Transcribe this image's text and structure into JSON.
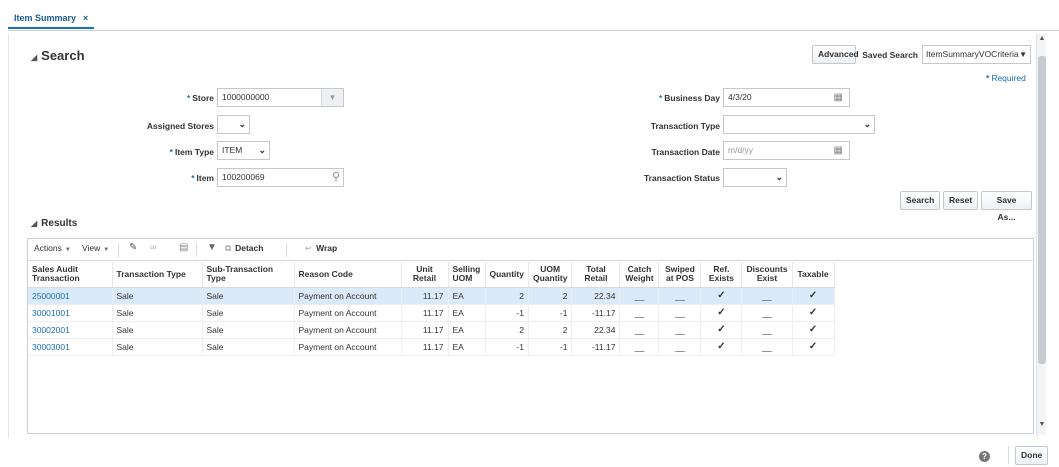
{
  "tab": {
    "label": "Item Summary",
    "close": "×"
  },
  "search": {
    "title": "Search",
    "advanced_label": "Advanced",
    "saved_search_label": "Saved Search",
    "saved_search_value": "ItemSummaryVOCriteria",
    "required_note": "Required",
    "fields": {
      "store": {
        "label": "Store",
        "value": "1000000000"
      },
      "assigned_stores": {
        "label": "Assigned Stores",
        "value": ""
      },
      "item_type": {
        "label": "Item Type",
        "value": "ITEM"
      },
      "item": {
        "label": "Item",
        "value": "100200069"
      },
      "business_day": {
        "label": "Business Day",
        "value": "4/3/20"
      },
      "transaction_type": {
        "label": "Transaction Type",
        "value": ""
      },
      "transaction_date": {
        "label": "Transaction Date",
        "placeholder": "m/d/yy"
      },
      "transaction_status": {
        "label": "Transaction Status",
        "value": ""
      }
    },
    "buttons": {
      "search": "Search",
      "reset": "Reset",
      "save_as": "Save As..."
    }
  },
  "results": {
    "title": "Results",
    "toolbar": {
      "actions": "Actions",
      "view": "View",
      "detach": "Detach",
      "wrap": "Wrap"
    },
    "columns": [
      "Sales Audit Transaction",
      "Transaction Type",
      "Sub-Transaction Type",
      "Reason Code",
      "Unit Retail",
      "Selling UOM",
      "Quantity",
      "UOM Quantity",
      "Total Retail",
      "Catch Weight",
      "Swiped at POS",
      "Ref. Exists",
      "Discounts Exist",
      "Taxable"
    ],
    "rows": [
      {
        "tran": "25000001",
        "type": "Sale",
        "sub": "Sale",
        "reason": "Payment on Account",
        "unit_retail": "11.17",
        "uom": "EA",
        "qty": "2",
        "uom_qty": "2",
        "total": "22.34",
        "catch": "__",
        "swiped": "__",
        "ref": "✓",
        "disc": "__",
        "tax": "✓"
      },
      {
        "tran": "30001001",
        "type": "Sale",
        "sub": "Sale",
        "reason": "Payment on Account",
        "unit_retail": "11.17",
        "uom": "EA",
        "qty": "-1",
        "uom_qty": "-1",
        "total": "-11.17",
        "catch": "__",
        "swiped": "__",
        "ref": "✓",
        "disc": "__",
        "tax": "✓"
      },
      {
        "tran": "30002001",
        "type": "Sale",
        "sub": "Sale",
        "reason": "Payment on Account",
        "unit_retail": "11.17",
        "uom": "EA",
        "qty": "2",
        "uom_qty": "2",
        "total": "22.34",
        "catch": "__",
        "swiped": "__",
        "ref": "✓",
        "disc": "__",
        "tax": "✓"
      },
      {
        "tran": "30003001",
        "type": "Sale",
        "sub": "Sale",
        "reason": "Payment on Account",
        "unit_retail": "11.17",
        "uom": "EA",
        "qty": "-1",
        "uom_qty": "-1",
        "total": "-11.17",
        "catch": "__",
        "swiped": "__",
        "ref": "✓",
        "disc": "__",
        "tax": "✓"
      }
    ]
  },
  "footer": {
    "help": "?",
    "done": "Done"
  }
}
